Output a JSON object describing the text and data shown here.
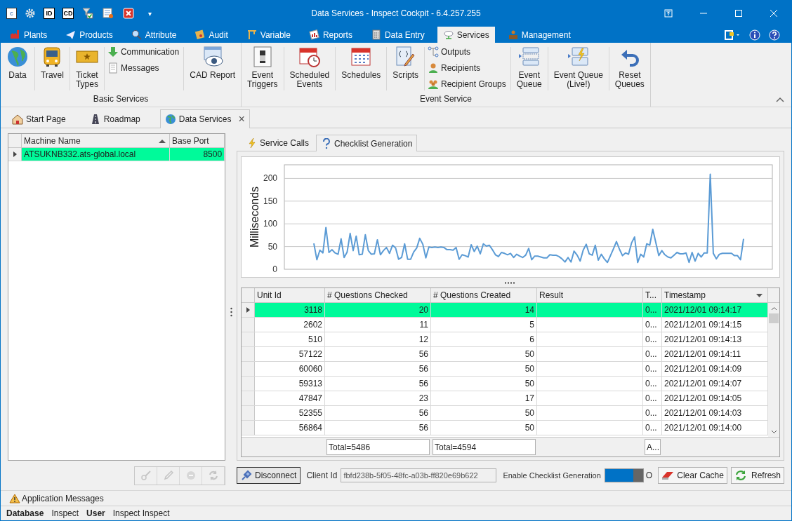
{
  "quick_access": [
    {
      "kind": "letter",
      "label": "c"
    },
    {
      "kind": "gear"
    },
    {
      "kind": "letter",
      "label": "ID"
    },
    {
      "kind": "letter",
      "label": "CD"
    },
    {
      "kind": "filter"
    },
    {
      "kind": "sheet"
    },
    {
      "kind": "delete"
    },
    {
      "kind": "caret",
      "label": "▾"
    }
  ],
  "window": {
    "title": "Data Services - Inspect Cockpit - 6.4.257.255"
  },
  "menu_tabs": [
    {
      "label": "Plants",
      "selected": false
    },
    {
      "label": "Products",
      "selected": false
    },
    {
      "label": "Attribute",
      "selected": false
    },
    {
      "label": "Audit",
      "selected": false
    },
    {
      "label": "Variable",
      "selected": false
    },
    {
      "label": "Reports",
      "selected": false
    },
    {
      "label": "Data Entry",
      "selected": false
    },
    {
      "label": "Services",
      "selected": true
    },
    {
      "label": "Management",
      "selected": false
    }
  ],
  "ribbon": [
    {
      "label": "Basic Services",
      "items": [
        {
          "kind": "large",
          "label": "Data"
        },
        {
          "kind": "large",
          "label": "Travel"
        },
        {
          "kind": "large",
          "label": "Ticket\nTypes"
        },
        {
          "kind": "stack",
          "items": [
            "Communication",
            "Messages"
          ]
        },
        {
          "kind": "large",
          "label": "CAD Report"
        }
      ]
    },
    {
      "label": "Event Service",
      "items": [
        {
          "kind": "large",
          "label": "Event\nTriggers"
        },
        {
          "kind": "large",
          "label": "Scheduled\nEvents"
        },
        {
          "kind": "large",
          "label": "Schedules"
        },
        {
          "kind": "large",
          "label": "Scripts"
        },
        {
          "kind": "stack",
          "items": [
            "Outputs",
            "Recipients",
            "Recipient Groups"
          ]
        },
        {
          "kind": "large",
          "label": "Event\nQueue"
        },
        {
          "kind": "large",
          "label": "Event Queue\n(Live!)"
        },
        {
          "kind": "large",
          "label": "Reset\nQueues"
        }
      ]
    }
  ],
  "doc_tabs": [
    {
      "label": "Start Page",
      "selected": false
    },
    {
      "label": "Roadmap",
      "selected": false
    },
    {
      "label": "Data Services",
      "selected": true,
      "close": "×"
    }
  ],
  "machines": {
    "columns": [
      "Machine Name",
      "Base Port"
    ],
    "rows": [
      {
        "cells": [
          "ATSUKNB332.ats-global.local",
          "8500"
        ],
        "selected": true
      }
    ]
  },
  "machine_buttons": [
    {
      "disabled": true
    },
    {
      "disabled": true
    },
    {
      "disabled": true
    },
    {
      "disabled": true
    }
  ],
  "sub_tabs": [
    {
      "label": "Service Calls",
      "selected": false
    },
    {
      "label": "Checklist Generation",
      "selected": true
    }
  ],
  "chart_data": {
    "type": "line",
    "ylabel": "Milliseconds",
    "ylim": [
      0,
      230
    ],
    "yticks": [
      0,
      50,
      100,
      150,
      200
    ],
    "grid": true,
    "series": [
      {
        "color": "#5b9bd5",
        "values": [
          57,
          21,
          42,
          36,
          92,
          37,
          43,
          36,
          33,
          67,
          26,
          38,
          79,
          41,
          73,
          32,
          33,
          76,
          41,
          33,
          34,
          65,
          32,
          41,
          48,
          35,
          53,
          47,
          22,
          26,
          56,
          22,
          22,
          38,
          47,
          68,
          55,
          25,
          49,
          48,
          49,
          48,
          49,
          48,
          43,
          43,
          42,
          48,
          22,
          32,
          30,
          27,
          54,
          39,
          51,
          34,
          56,
          51,
          53,
          43,
          32,
          28,
          37,
          35,
          32,
          35,
          26,
          33,
          29,
          26,
          31,
          46,
          21,
          29,
          29,
          27,
          25,
          25,
          32,
          31,
          31,
          28,
          23,
          16,
          26,
          16,
          40,
          31,
          18,
          42,
          55,
          34,
          31,
          53,
          20,
          33,
          23,
          15,
          30,
          45,
          61,
          44,
          30,
          36,
          33,
          58,
          71,
          15,
          33,
          27,
          56,
          53,
          88,
          59,
          30,
          41,
          32,
          27,
          25,
          31,
          37,
          34,
          34,
          36,
          15,
          37,
          18,
          35,
          27,
          36,
          36,
          209,
          35,
          23,
          33,
          35,
          35,
          35,
          35,
          30,
          30,
          21,
          67
        ]
      }
    ]
  },
  "checklist": {
    "columns": [
      "Unit Id",
      "# Questions Checked",
      "# Questions Created",
      "Result",
      "T...",
      "Timestamp"
    ],
    "rows": [
      {
        "cells": [
          "3118",
          "20",
          "14",
          "",
          "0...",
          "2021/12/01 09:14:17"
        ],
        "selected": true
      },
      {
        "cells": [
          "2602",
          "11",
          "5",
          "",
          "0...",
          "2021/12/01 09:14:15"
        ],
        "selected": false
      },
      {
        "cells": [
          "510",
          "12",
          "6",
          "",
          "0...",
          "2021/12/01 09:14:13"
        ],
        "selected": false
      },
      {
        "cells": [
          "57122",
          "56",
          "50",
          "",
          "0...",
          "2021/12/01 09:14:11"
        ],
        "selected": false
      },
      {
        "cells": [
          "60060",
          "56",
          "50",
          "",
          "0...",
          "2021/12/01 09:14:09"
        ],
        "selected": false
      },
      {
        "cells": [
          "59313",
          "56",
          "50",
          "",
          "0...",
          "2021/12/01 09:14:07"
        ],
        "selected": false
      },
      {
        "cells": [
          "47847",
          "23",
          "17",
          "",
          "0...",
          "2021/12/01 09:14:05"
        ],
        "selected": false
      },
      {
        "cells": [
          "52355",
          "56",
          "50",
          "",
          "0...",
          "2021/12/01 09:14:03"
        ],
        "selected": false
      },
      {
        "cells": [
          "56864",
          "56",
          "50",
          "",
          "0...",
          "2021/12/01 09:14:00"
        ],
        "selected": false
      }
    ],
    "totals": {
      "questions_checked": "Total=5486",
      "questions_created": "Total=4594",
      "column_5": "A..."
    }
  },
  "controls": {
    "disconnect": "Disconnect",
    "client_id_label": "Client Id",
    "client_id": "fbfd238b-5f05-48fc-a03b-ff820e69b622",
    "toggle_label": "Enable Checklist Generation",
    "toggle_on": true,
    "toggle_text": "O",
    "clear_cache": "Clear Cache",
    "refresh": "Refresh"
  },
  "app_messages": "Application Messages",
  "status_bar": [
    {
      "label": "Database",
      "value": "Inspect"
    },
    {
      "label": "User",
      "value": "Inspect Inspect"
    }
  ]
}
